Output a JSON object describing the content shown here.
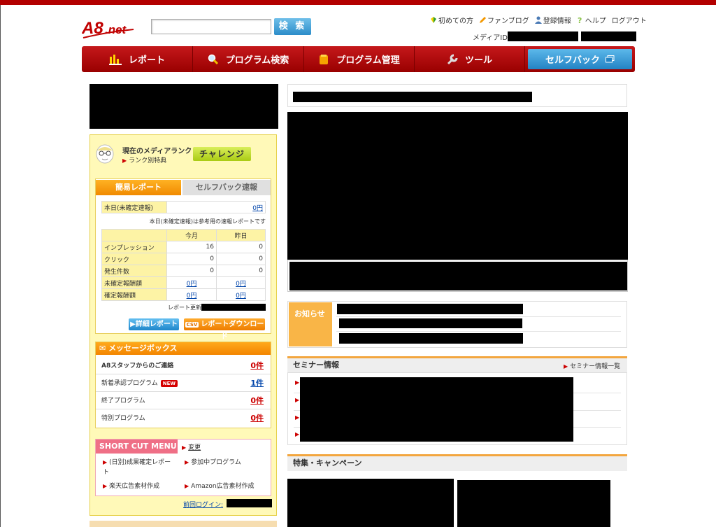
{
  "brand": {
    "logo_text": "A8.net",
    "accent": "#b30000"
  },
  "search": {
    "button_label": "検 索",
    "placeholder": ""
  },
  "top_links": [
    {
      "label": "初めての方",
      "icon": "beginner-leaf-icon"
    },
    {
      "label": "ファンブログ",
      "icon": "pencil-icon"
    },
    {
      "label": "登録情報",
      "icon": "user-icon"
    },
    {
      "label": "ヘルプ",
      "icon": "question-icon"
    },
    {
      "label": "ログアウト",
      "icon": ""
    }
  ],
  "media_id_label": "メディアID:",
  "nav": {
    "report": "レポート",
    "program_search": "プログラム検索",
    "program_manage": "プログラム管理",
    "tool": "ツール",
    "selfback": "セルフバック"
  },
  "rank": {
    "title": "現在のメディアランク",
    "link": "ランク別特典",
    "challenge": "チャレンジ"
  },
  "report": {
    "tab_simple": "簡易レポート",
    "tab_selfback": "セルフバック速報",
    "today_label": "本日(未確定速報)",
    "today_value": "0円",
    "note": "本日(未確定速報)は参考用の速報レポートです",
    "col_this_month": "今月",
    "col_yesterday": "昨日",
    "rows": [
      {
        "label": "インプレッション",
        "month": "16",
        "yesterday": "0",
        "link": false
      },
      {
        "label": "クリック",
        "month": "0",
        "yesterday": "0",
        "link": false
      },
      {
        "label": "発生件数",
        "month": "0",
        "yesterday": "0",
        "link": false
      },
      {
        "label": "未確定報酬額",
        "month": "0円",
        "yesterday": "0円",
        "link": true
      },
      {
        "label": "確定報酬額",
        "month": "0円",
        "yesterday": "0円",
        "link": true
      }
    ],
    "updated_label": "レポート更新:",
    "detail_button": "詳細レポート",
    "download_button": "レポートダウンロード",
    "csv_badge": "CSV"
  },
  "messages": {
    "title": "メッセージボックス",
    "items": [
      {
        "label": "A8スタッフからのご連絡",
        "count": "0件",
        "bold": true,
        "new": false
      },
      {
        "label": "新着承認プログラム",
        "count": "1件",
        "bold": false,
        "new": true
      },
      {
        "label": "終了プログラム",
        "count": "0件",
        "bold": false,
        "new": false
      },
      {
        "label": "特別プログラム",
        "count": "0件",
        "bold": false,
        "new": false
      }
    ],
    "new_badge": "NEW"
  },
  "shortcut": {
    "title": "SHORT CUT MENU",
    "change": "変更",
    "links": [
      "(日別)成果確定レポート",
      "参加中プログラム",
      "楽天広告素材作成",
      "Amazon広告素材作成"
    ]
  },
  "last_login_label": "前回ログイン:",
  "news": {
    "title": "お知らせ"
  },
  "seminar": {
    "title": "セミナー情報",
    "more": "セミナー情報一覧"
  },
  "campaign": {
    "title": "特集・キャンペーン"
  }
}
